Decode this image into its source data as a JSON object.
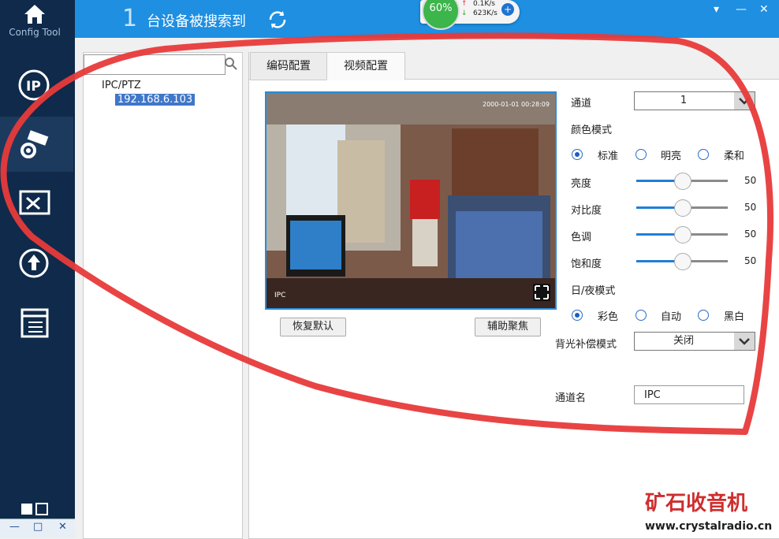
{
  "app": {
    "logo_label": "Config Tool"
  },
  "topbar": {
    "device_count": "1",
    "found_text": "台设备被搜索到"
  },
  "net_widget": {
    "percent": "60%",
    "upload": "0.1K/s",
    "download": "623K/s"
  },
  "sidebar": {
    "items": [
      {
        "icon": "ip-icon"
      },
      {
        "icon": "camera-settings-icon",
        "active": true
      },
      {
        "icon": "tools-icon"
      },
      {
        "icon": "upgrade-icon"
      },
      {
        "icon": "list-icon"
      }
    ]
  },
  "tree": {
    "root": "IPC/PTZ",
    "device_ip": "192.168.6.103"
  },
  "tabs": [
    {
      "label": "编码配置"
    },
    {
      "label": "视频配置",
      "active": true
    }
  ],
  "video": {
    "timestamp": "2000-01-01 00:28:09",
    "osd": "IPC"
  },
  "buttons": {
    "restore_default": "恢复默认",
    "assist_focus": "辅助聚焦"
  },
  "settings": {
    "channel_label": "通道",
    "channel_value": "1",
    "color_mode_label": "颜色模式",
    "color_modes": [
      "标准",
      "明亮",
      "柔和"
    ],
    "color_mode_selected": "标准",
    "sliders": [
      {
        "label": "亮度",
        "value": 50
      },
      {
        "label": "对比度",
        "value": 50
      },
      {
        "label": "色调",
        "value": 50
      },
      {
        "label": "饱和度",
        "value": 50
      }
    ],
    "day_night_label": "日/夜模式",
    "day_night_modes": [
      "彩色",
      "自动",
      "黑白"
    ],
    "day_night_selected": "彩色",
    "backlight_label": "背光补偿模式",
    "backlight_value": "关闭",
    "channel_name_label": "通道名",
    "channel_name_value": "IPC"
  },
  "watermark": {
    "title": "矿石收音机",
    "url": "www.crystalradio.cn"
  },
  "colors": {
    "sidebar": "#0f2a4a",
    "topbar": "#1e8fe1",
    "accent": "#1e7fd8",
    "annotation": "#e83a3a"
  }
}
